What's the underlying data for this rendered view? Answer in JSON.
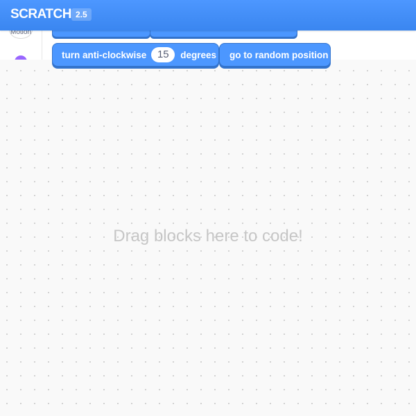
{
  "header": {
    "title": "SCRATCH",
    "version": "2.5"
  },
  "palette": {
    "categories": [
      {
        "label": "Motion",
        "color": "#4c97ff"
      },
      {
        "label": "",
        "color": "#9966ff"
      }
    ],
    "blocks": [
      {
        "text_before": "turn anti-clockwise",
        "input_value": "15",
        "text_after": "degrees",
        "color": "#4c97ff"
      },
      {
        "text": "go to random position",
        "color": "#4c97ff"
      }
    ]
  },
  "workspace": {
    "hint": "Drag blocks here to code!"
  },
  "colors": {
    "header": "#4d97ff",
    "motion": "#4c97ff",
    "motion_border": "#3373cc",
    "looks": "#9966ff",
    "workspace_bg": "#f9f9f9"
  }
}
